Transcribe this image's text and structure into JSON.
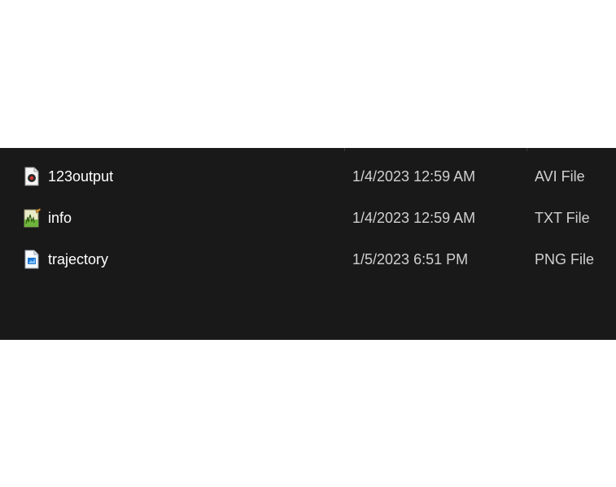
{
  "file_list": {
    "rows": [
      {
        "name": "123output",
        "date_modified": "1/4/2023 12:59 AM",
        "type": "AVI File",
        "icon": "video-file-icon"
      },
      {
        "name": "info",
        "date_modified": "1/4/2023 12:59 AM",
        "type": "TXT File",
        "icon": "text-file-icon"
      },
      {
        "name": "trajectory",
        "date_modified": "1/5/2023 6:51 PM",
        "type": "PNG File",
        "icon": "image-file-icon"
      }
    ]
  },
  "colors": {
    "panel_background": "#191919",
    "name_text": "#ffffff",
    "detail_text": "#d0d0d0"
  }
}
